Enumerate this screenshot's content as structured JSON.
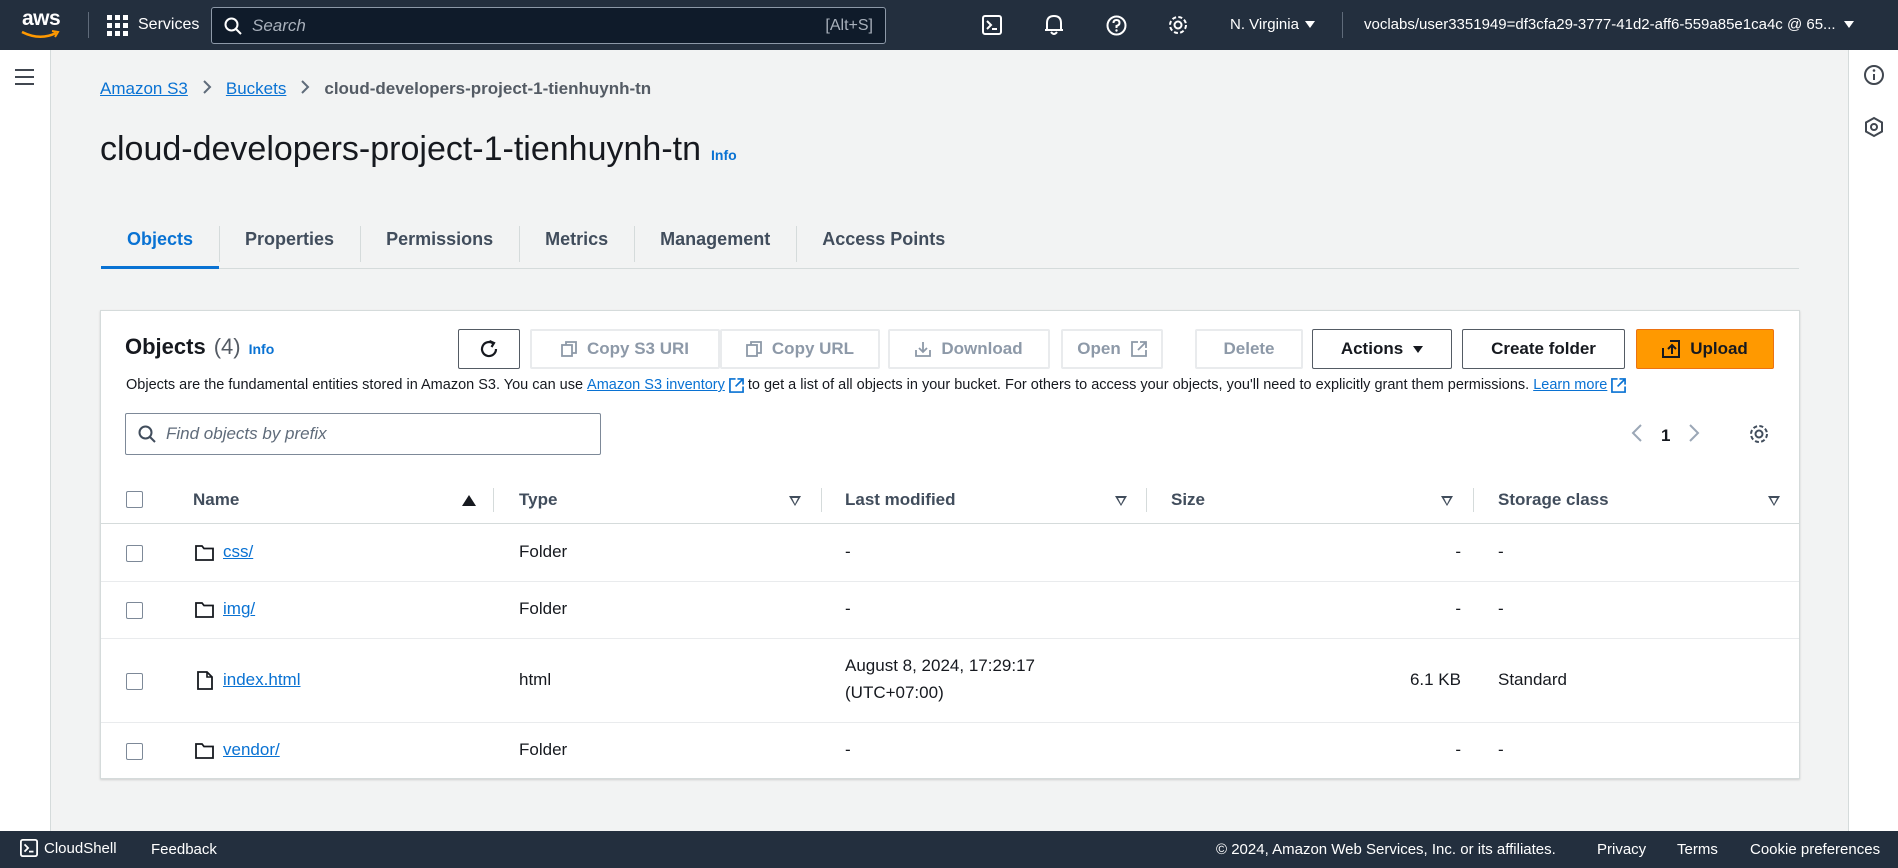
{
  "topnav": {
    "logo_text": "aws",
    "services_label": "Services",
    "search_placeholder": "Search",
    "search_shortcut": "[Alt+S]",
    "region": "N. Virginia",
    "user": "voclabs/user3351949=df3cfa29-3777-41d2-aff6-559a85e1ca4c @ 65...",
    "icons": [
      "cloudshell-icon",
      "bell-icon",
      "help-icon",
      "settings-icon"
    ]
  },
  "breadcrumb": {
    "items": [
      "Amazon S3",
      "Buckets"
    ],
    "current": "cloud-developers-project-1-tienhuynh-tn"
  },
  "page": {
    "title": "cloud-developers-project-1-tienhuynh-tn",
    "info": "Info"
  },
  "tabs": [
    "Objects",
    "Properties",
    "Permissions",
    "Metrics",
    "Management",
    "Access Points"
  ],
  "objects_panel": {
    "heading": "Objects",
    "count": "(4)",
    "info": "Info",
    "desc_before": "Objects are the fundamental entities stored in Amazon S3. You can use",
    "desc_link": "Amazon S3 inventory",
    "desc_after": "to get a list of all objects in your bucket. For others to access your objects, you'll need to explicitly grant them permissions.",
    "learn_more": "Learn more",
    "buttons": {
      "copy_s3_uri": "Copy S3 URI",
      "copy_url": "Copy URL",
      "download": "Download",
      "open": "Open",
      "delete": "Delete",
      "actions": "Actions",
      "create_folder": "Create folder",
      "upload": "Upload"
    },
    "prefix_placeholder": "Find objects by prefix",
    "page_number": "1"
  },
  "table": {
    "columns": [
      "Name",
      "Type",
      "Last modified",
      "Size",
      "Storage class"
    ],
    "rows": [
      {
        "name": "css/",
        "kind": "folder",
        "type": "Folder",
        "modified": "-",
        "modified2": "",
        "size": "-",
        "storage": "-"
      },
      {
        "name": "img/",
        "kind": "folder",
        "type": "Folder",
        "modified": "-",
        "modified2": "",
        "size": "-",
        "storage": "-"
      },
      {
        "name": "index.html",
        "kind": "file",
        "type": "html",
        "modified": "August 8, 2024, 17:29:17",
        "modified2": "(UTC+07:00)",
        "size": "6.1 KB",
        "storage": "Standard"
      },
      {
        "name": "vendor/",
        "kind": "folder",
        "type": "Folder",
        "modified": "-",
        "modified2": "",
        "size": "-",
        "storage": "-"
      }
    ]
  },
  "footer": {
    "cloudshell": "CloudShell",
    "feedback": "Feedback",
    "copyright": "© 2024, Amazon Web Services, Inc. or its affiliates.",
    "privacy": "Privacy",
    "terms": "Terms",
    "cookies": "Cookie preferences"
  },
  "colors": {
    "nav_bg": "#232f3e",
    "link": "#0972d3",
    "primary": "#ff9900"
  }
}
